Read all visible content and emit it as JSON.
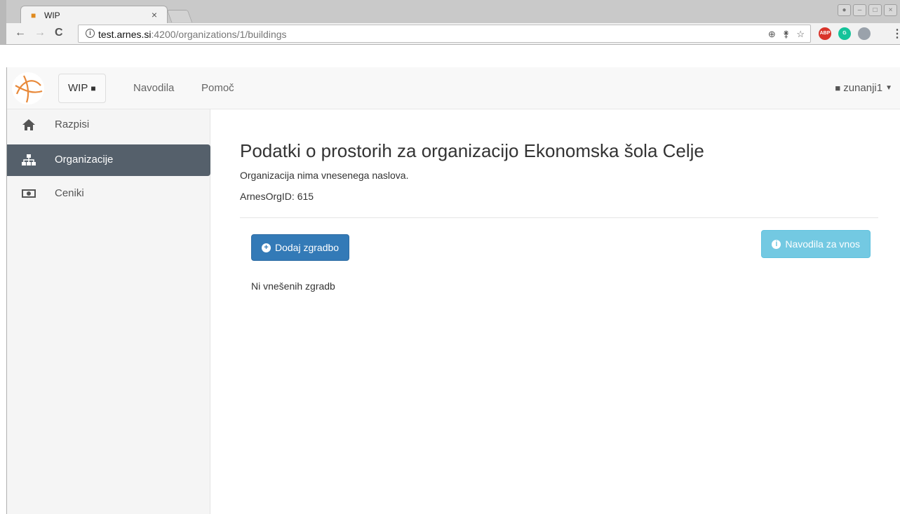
{
  "browser": {
    "tab_title": "WIP",
    "tab_close": "×",
    "url_host": "test.arnes.si",
    "url_path": ":4200/organizations/1/buildings",
    "extensions": [
      {
        "name": "adblock-icon",
        "label": "ABP",
        "color": "#d9342b"
      },
      {
        "name": "grammarly-icon",
        "label": "G",
        "color": "#15c39a"
      },
      {
        "name": "ghostery-icon",
        "label": "",
        "color": "#9aa2ab"
      }
    ]
  },
  "navbar": {
    "brand_label": "WIP",
    "links": [
      "Navodila",
      "Pomoč"
    ],
    "user": "zunanji1"
  },
  "sidebar": {
    "items": [
      {
        "label": "Razpisi",
        "icon": "home-icon",
        "active": false
      },
      {
        "label": "Organizacije",
        "icon": "sitemap-icon",
        "active": true
      },
      {
        "label": "Ceniki",
        "icon": "money-icon",
        "active": false
      }
    ]
  },
  "main": {
    "title": "Podatki o prostorih za organizacijo Ekonomska šola Celje",
    "address_note": "Organizacija nima vnesenega naslova.",
    "org_id_label": "ArnesOrgID: ",
    "org_id_value": "615",
    "add_button": "Dodaj zgradbo",
    "help_button": "Navodila za vnos",
    "empty_message": "Ni vnešenih zgradb"
  },
  "colors": {
    "primary": "#337ab7",
    "info": "#5bc0de",
    "sidebar_active": "#55606b"
  }
}
